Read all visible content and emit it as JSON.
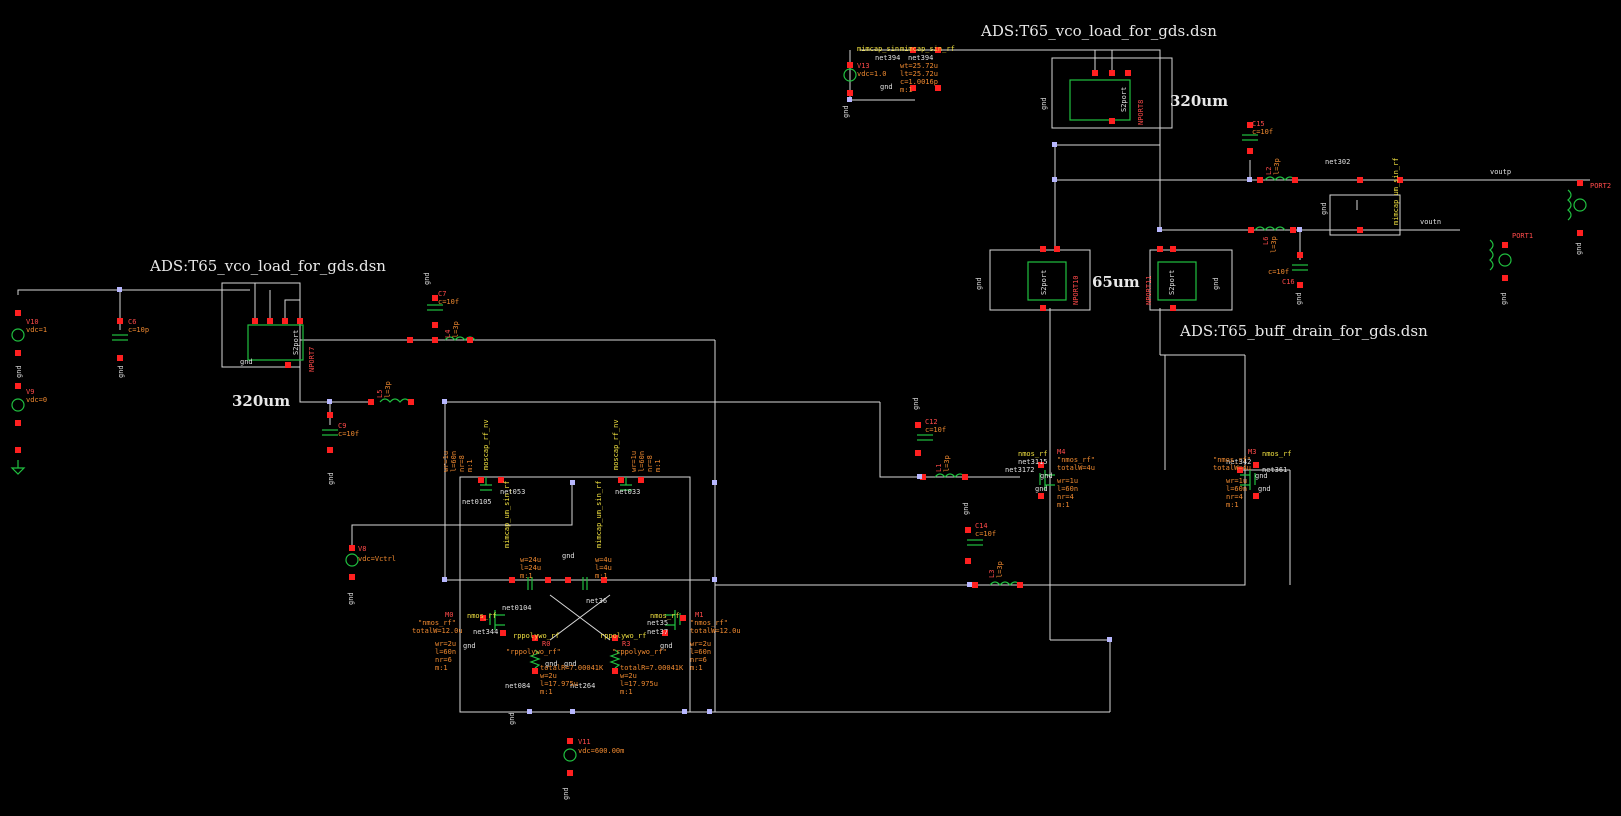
{
  "titles": {
    "top_right": "ADS:T65_vco_load_for_gds.dsn",
    "left": "ADS:T65_vco_load_for_gds.dsn",
    "buffer": "ADS:T65_buff_drain_for_gds.dsn"
  },
  "sizes": {
    "left_320": "320um",
    "right_320": "320um",
    "mid_65": "65um"
  },
  "nets": {
    "voutp": "voutp",
    "voutn": "voutn",
    "gnd": "gnd",
    "net344": "net344",
    "net37": "net37",
    "net35": "net35",
    "net36": "net36",
    "net084": "net084",
    "net264": "net264",
    "net3115": "net3115",
    "net3172": "net3172",
    "net342": "net342",
    "net361": "net361",
    "net302": "net302",
    "net394": "net394",
    "net394b": "net394",
    "net053": "net053",
    "net033": "net033",
    "net0105": "net0105",
    "net0104": "net0104"
  },
  "sources": {
    "v10": "V10",
    "v10_val": "vdc=1",
    "v9": "V9",
    "v9_val": "vdc=0",
    "v8": "V8",
    "v8_val": "vdc=Vctrl",
    "v11": "V11",
    "v11_val": "vdc=600.00m",
    "v13": "V13",
    "v13_val": "vdc=1.0"
  },
  "caps": {
    "c6": "C6",
    "c6_val": "c=10p",
    "c7": "C7",
    "c7_val": "c=10f",
    "c9": "C9",
    "c9_val": "c=10f",
    "c12": "C12",
    "c12_val": "c=10f",
    "c14": "C14",
    "c14_val": "c=10f",
    "c15": "C15",
    "c15_val": "c=10f",
    "c16": "C16",
    "c16_val": "c=10f"
  },
  "inductors": {
    "l4": "L4",
    "l4_val": "l=3p",
    "l5": "L5",
    "l5_val": "l=3p",
    "l1": "L1",
    "l1_val": "l=3p",
    "l3": "L3",
    "l3_val": "l=3p",
    "l2": "L2",
    "l2_val": "l=3p",
    "l6": "L6",
    "l6_val": "l=3p"
  },
  "transistors": {
    "m0_name": "M0",
    "m0_type": "nmos_rf",
    "m0_model": "\"nmos_rf\"",
    "m0_tw": "totalW=12.0u",
    "m0_params": [
      "wr=2u",
      "l=60n",
      "nr=6",
      "m:1"
    ],
    "m1_name": "M1",
    "m1_type": "nmos_rf",
    "m1_model": "\"nmos_rf\"",
    "m1_tw": "totalW=12.0u",
    "m1_params": [
      "wr=2u",
      "l=60n",
      "nr=6",
      "m:1"
    ],
    "m4_name": "M4",
    "m4_type": "nmos_rf",
    "m4_model": "\"nmos_rf\"",
    "m4_tw": "totalW=4u",
    "m4_params": [
      "wr=1u",
      "l=60n",
      "nr=4",
      "m:1"
    ],
    "m3_name": "M3",
    "m3_type": "nmos_rf",
    "m3_model": "\"nmos_rf\"",
    "m3_tw": "totalW=4u",
    "m3_params": [
      "wr=1u",
      "l=60n",
      "nr=4",
      "m:1"
    ]
  },
  "resistors": {
    "r0": "R0",
    "r0_type": "rppolywo_rf",
    "r0_model": "\"rppolywo_rf\"",
    "r0_params": [
      "totalR=7.00041K",
      "w=2u",
      "l=17.975u",
      "m:1"
    ],
    "r3": "R3",
    "r3_type": "rppolywo_rf",
    "r3_model": "\"rppolywo_rf\"",
    "r3_params": [
      "totalR=7.00041K",
      "w=2u",
      "l=17.975u",
      "m:1"
    ]
  },
  "varactors": {
    "cv_left_model": "moscap_rf_nv",
    "cv_right_model": "moscap_rf_nv",
    "cv_left_params": [
      "wr=1u",
      "l=60n",
      "nr=8",
      "m:1"
    ],
    "cv_right_params": [
      "wr=1u",
      "l=60n",
      "nr=8",
      "m:1"
    ],
    "c8_label": "mimcap_um_sin_rf",
    "c1_label": "mimcap_um_sin_rf",
    "c8_params": [
      "w=24u",
      "l=24u",
      "m:1"
    ],
    "c1_params": [
      "w=4u",
      "l=4u",
      "m:1"
    ]
  },
  "top_mim": {
    "label_a": "mimcap_sin",
    "label_b": "mimcap_sin_rf",
    "params": [
      "wt=25.72u",
      "lt=25.72u",
      "c=1.0016p",
      "m:1"
    ]
  },
  "ports": {
    "port1": "PORT1",
    "port2": "PORT2",
    "np_left": "NPORT7",
    "np_top": "NPORT8",
    "np_mid": "NPORT10",
    "np_buf": "NPORT11",
    "sparam": "S2port"
  },
  "right_mim_label": "mimcap_um_sin_rf"
}
